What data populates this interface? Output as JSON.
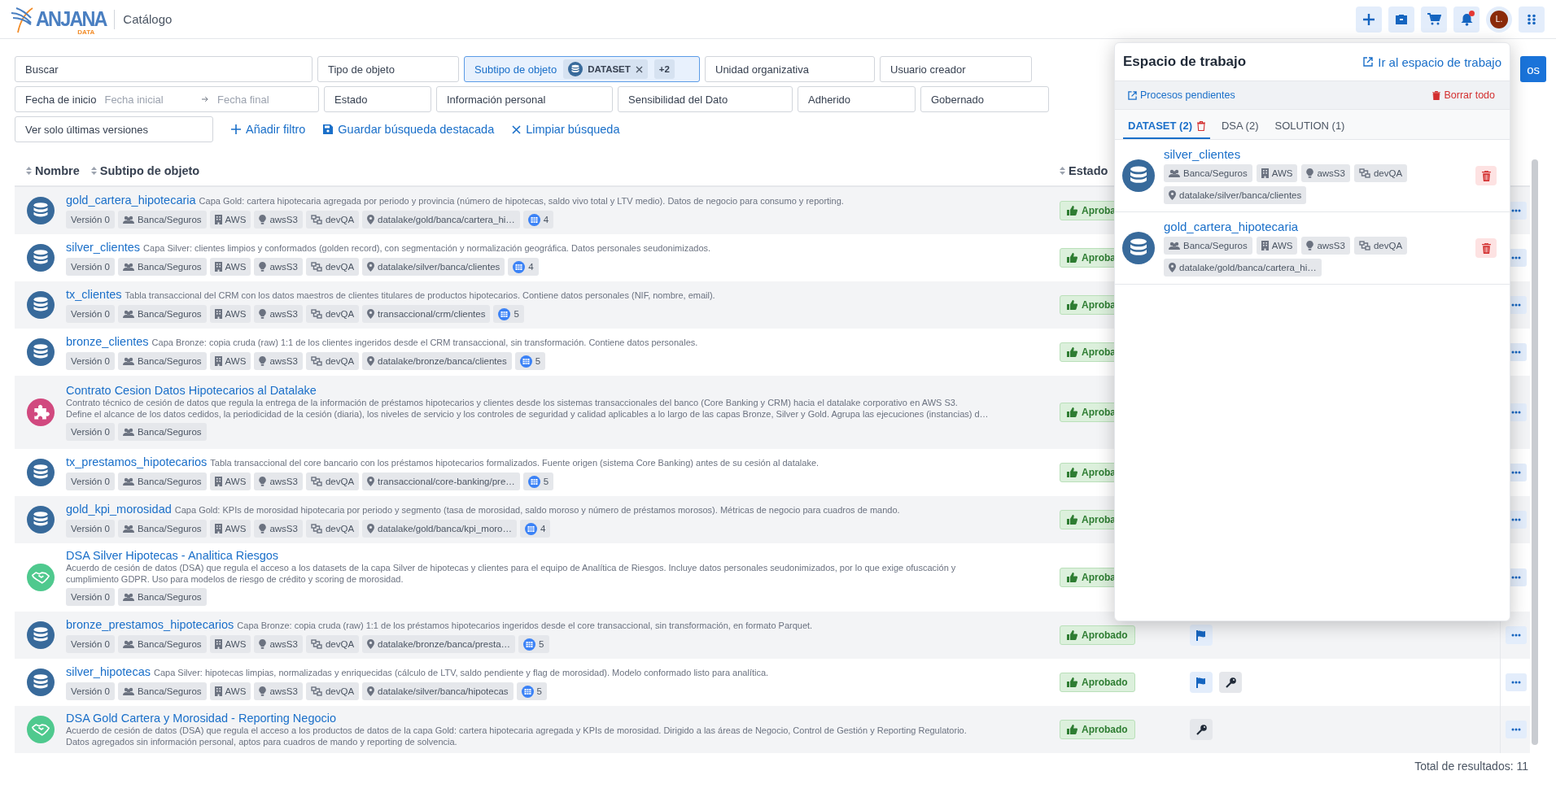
{
  "header": {
    "logo": {
      "name": "ANJANA",
      "sub": "DATA"
    },
    "section": "Catálogo",
    "buttons": [
      {
        "kind": "add"
      },
      {
        "kind": "briefcase"
      },
      {
        "kind": "cart"
      },
      {
        "kind": "bell",
        "notification": true
      },
      {
        "kind": "avatar",
        "label": "L."
      },
      {
        "kind": "apps"
      }
    ]
  },
  "filters": {
    "fields": [
      {
        "label": "Buscar",
        "active": false
      },
      {
        "label": "Tipo de objeto",
        "active": false
      },
      {
        "label": "Subtipo de objeto",
        "active": true,
        "chips": [
          {
            "label": "DATASET",
            "kind": "dataset",
            "removable": true
          },
          {
            "label": "+2",
            "kind": "count",
            "removable": false
          }
        ]
      },
      {
        "label": "Unidad organizativa",
        "active": false
      },
      {
        "label": "Usuario creador",
        "active": false
      },
      {
        "kind": "date_range",
        "label": "Fecha de inicio",
        "from_placeholder": "Fecha inicial",
        "to_placeholder": "Fecha final",
        "active": false
      },
      {
        "label": "Estado",
        "active": false
      },
      {
        "label": "Información personal",
        "active": false
      },
      {
        "label": "Sensibilidad del Dato",
        "active": false
      },
      {
        "label": "Adherido",
        "active": false
      },
      {
        "label": "Gobernado",
        "active": false
      },
      {
        "label": "Ver solo últimas versiones",
        "active": false
      }
    ],
    "actions": [
      {
        "kind": "add",
        "label": "Añadir filtro"
      },
      {
        "kind": "save",
        "label": "Guardar búsqueda destacada"
      },
      {
        "kind": "clear",
        "label": "Limpiar búsqueda"
      }
    ],
    "search_button": "os"
  },
  "table": {
    "columns": [
      {
        "label": "Nombre",
        "sortable": true
      },
      {
        "label": "Subtipo de objeto",
        "sortable": true
      },
      {
        "label": "Estado",
        "sortable": true
      }
    ],
    "rows": [
      {
        "kind": "dataset",
        "name": "gold_cartera_hipotecaria",
        "description": "Capa Gold: cartera hipotecaria agregada por periodo y provincia (número de hipotecas, saldo vivo total y LTV medio). Datos de negocio para consumo y reporting.",
        "tags": [
          {
            "kind": "version",
            "label": "Versión 0"
          },
          {
            "kind": "domain",
            "label": "Banca/Seguros"
          },
          {
            "kind": "system",
            "label": "AWS"
          },
          {
            "kind": "tech",
            "label": "awsS3"
          },
          {
            "kind": "env",
            "label": "devQA"
          },
          {
            "kind": "path",
            "label": "datalake/gold/banca/cartera_hi…"
          },
          {
            "kind": "columns",
            "label": "4"
          }
        ],
        "status": "Aproba"
      },
      {
        "kind": "dataset",
        "name": "silver_clientes",
        "description": "Capa Silver: clientes limpios y conformados (golden record), con segmentación y normalización geográfica. Datos personales seudonimizados.",
        "tags": [
          {
            "kind": "version",
            "label": "Versión 0"
          },
          {
            "kind": "domain",
            "label": "Banca/Seguros"
          },
          {
            "kind": "system",
            "label": "AWS"
          },
          {
            "kind": "tech",
            "label": "awsS3"
          },
          {
            "kind": "env",
            "label": "devQA"
          },
          {
            "kind": "path",
            "label": "datalake/silver/banca/clientes"
          },
          {
            "kind": "columns",
            "label": "4"
          }
        ],
        "status": "Aproba"
      },
      {
        "kind": "dataset",
        "name": "tx_clientes",
        "description": "Tabla transaccional del CRM con los datos maestros de clientes titulares de productos hipotecarios. Contiene datos personales (NIF, nombre, email).",
        "tags": [
          {
            "kind": "version",
            "label": "Versión 0"
          },
          {
            "kind": "domain",
            "label": "Banca/Seguros"
          },
          {
            "kind": "system",
            "label": "AWS"
          },
          {
            "kind": "tech",
            "label": "awsS3"
          },
          {
            "kind": "env",
            "label": "devQA"
          },
          {
            "kind": "path",
            "label": "transaccional/crm/clientes"
          },
          {
            "kind": "columns",
            "label": "5"
          }
        ],
        "status": "Aproba"
      },
      {
        "kind": "dataset",
        "name": "bronze_clientes",
        "description": "Capa Bronze: copia cruda (raw) 1:1 de los clientes ingeridos desde el CRM transaccional, sin transformación. Contiene datos personales.",
        "tags": [
          {
            "kind": "version",
            "label": "Versión 0"
          },
          {
            "kind": "domain",
            "label": "Banca/Seguros"
          },
          {
            "kind": "system",
            "label": "AWS"
          },
          {
            "kind": "tech",
            "label": "awsS3"
          },
          {
            "kind": "env",
            "label": "devQA"
          },
          {
            "kind": "path",
            "label": "datalake/bronze/banca/clientes"
          },
          {
            "kind": "columns",
            "label": "5"
          }
        ],
        "status": "Aproba"
      },
      {
        "kind": "contract",
        "name": "Contrato Cesion Datos Hipotecarios al Datalake",
        "description_lines": [
          "Contrato técnico de cesión de datos que regula la entrega de la información de préstamos hipotecarios y clientes desde los sistemas transaccionales del banco (Core Banking y CRM) hacia el datalake corporativo en AWS S3.",
          "Define el alcance de los datos cedidos, la periodicidad de la cesión (diaria), los niveles de servicio y los controles de seguridad y calidad aplicables a lo largo de las capas Bronze, Silver y Gold. Agrupa las ejecuciones (instancias) d…"
        ],
        "tags": [
          {
            "kind": "version",
            "label": "Versión 0"
          },
          {
            "kind": "domain",
            "label": "Banca/Seguros"
          }
        ],
        "status": "Aproba"
      },
      {
        "kind": "dataset",
        "name": "tx_prestamos_hipotecarios",
        "description": "Tabla transaccional del core bancario con los préstamos hipotecarios formalizados. Fuente origen (sistema Core Banking) antes de su cesión al datalake.",
        "tags": [
          {
            "kind": "version",
            "label": "Versión 0"
          },
          {
            "kind": "domain",
            "label": "Banca/Seguros"
          },
          {
            "kind": "system",
            "label": "AWS"
          },
          {
            "kind": "tech",
            "label": "awsS3"
          },
          {
            "kind": "env",
            "label": "devQA"
          },
          {
            "kind": "path",
            "label": "transaccional/core-banking/pre…"
          },
          {
            "kind": "columns",
            "label": "5"
          }
        ],
        "status": "Aproba"
      },
      {
        "kind": "dataset",
        "name": "gold_kpi_morosidad",
        "description": "Capa Gold: KPIs de morosidad hipotecaria por periodo y segmento (tasa de morosidad, saldo moroso y número de préstamos morosos). Métricas de negocio para cuadros de mando.",
        "tags": [
          {
            "kind": "version",
            "label": "Versión 0"
          },
          {
            "kind": "domain",
            "label": "Banca/Seguros"
          },
          {
            "kind": "system",
            "label": "AWS"
          },
          {
            "kind": "tech",
            "label": "awsS3"
          },
          {
            "kind": "env",
            "label": "devQA"
          },
          {
            "kind": "path",
            "label": "datalake/gold/banca/kpi_moro…"
          },
          {
            "kind": "columns",
            "label": "4"
          }
        ],
        "status": "Aproba"
      },
      {
        "kind": "dsa",
        "name": "DSA Silver Hipotecas - Analitica Riesgos",
        "description_lines": [
          "Acuerdo de cesión de datos (DSA) que regula el acceso a los datasets de la capa Silver de hipotecas y clientes para el equipo de Analítica de Riesgos. Incluye datos personales seudonimizados, por lo que exige ofuscación y",
          "cumplimiento GDPR. Uso para modelos de riesgo de crédito y scoring de morosidad."
        ],
        "tags": [
          {
            "kind": "version",
            "label": "Versión 0"
          },
          {
            "kind": "domain",
            "label": "Banca/Seguros"
          }
        ],
        "status": "Aproba"
      },
      {
        "kind": "dataset",
        "name": "bronze_prestamos_hipotecarios",
        "description": "Capa Bronze: copia cruda (raw) 1:1 de los préstamos hipotecarios ingeridos desde el core transaccional, sin transformación, en formato Parquet.",
        "tags": [
          {
            "kind": "version",
            "label": "Versión 0"
          },
          {
            "kind": "domain",
            "label": "Banca/Seguros"
          },
          {
            "kind": "system",
            "label": "AWS"
          },
          {
            "kind": "tech",
            "label": "awsS3"
          },
          {
            "kind": "env",
            "label": "devQA"
          },
          {
            "kind": "path",
            "label": "datalake/bronze/banca/presta…"
          },
          {
            "kind": "columns",
            "label": "5"
          }
        ],
        "status": "Aprobado",
        "markers": [
          {
            "kind": "flag"
          }
        ]
      },
      {
        "kind": "dataset",
        "name": "silver_hipotecas",
        "description": "Capa Silver: hipotecas limpias, normalizadas y enriquecidas (cálculo de LTV, saldo pendiente y flag de morosidad). Modelo conformado listo para analítica.",
        "tags": [
          {
            "kind": "version",
            "label": "Versión 0"
          },
          {
            "kind": "domain",
            "label": "Banca/Seguros"
          },
          {
            "kind": "system",
            "label": "AWS"
          },
          {
            "kind": "tech",
            "label": "awsS3"
          },
          {
            "kind": "env",
            "label": "devQA"
          },
          {
            "kind": "path",
            "label": "datalake/silver/banca/hipotecas"
          },
          {
            "kind": "columns",
            "label": "5"
          }
        ],
        "status": "Aprobado",
        "markers": [
          {
            "kind": "flag"
          },
          {
            "kind": "key"
          }
        ]
      },
      {
        "kind": "dsa",
        "name": "DSA Gold Cartera y Morosidad - Reporting Negocio",
        "description_lines": [
          "Acuerdo de cesión de datos (DSA) que regula el acceso a los productos de datos de la capa Gold: cartera hipotecaria agregada y KPIs de morosidad. Dirigido a las áreas de Negocio, Control de Gestión y Reporting Regulatorio.",
          "Datos agregados sin información personal, aptos para cuadros de mando y reporting de solvencia."
        ],
        "status": "Aprobado",
        "markers": [
          {
            "kind": "key"
          }
        ]
      }
    ],
    "total": "Total de resultados: 11"
  },
  "workspace": {
    "title": "Espacio de trabajo",
    "open_link": "Ir al espacio de trabajo",
    "pending_link": "Procesos pendientes",
    "clear_all": "Borrar todo",
    "tabs": [
      {
        "label": "DATASET (2)",
        "selected": true
      },
      {
        "label": "DSA (2)",
        "selected": false
      },
      {
        "label": "SOLUTION (1)",
        "selected": false
      }
    ],
    "items": [
      {
        "kind": "dataset",
        "name": "silver_clientes",
        "tags": [
          {
            "kind": "domain",
            "label": "Banca/Seguros"
          },
          {
            "kind": "system",
            "label": "AWS"
          },
          {
            "kind": "tech",
            "label": "awsS3"
          },
          {
            "kind": "env",
            "label": "devQA"
          },
          {
            "kind": "path",
            "label": "datalake/silver/banca/clientes"
          }
        ]
      },
      {
        "kind": "dataset",
        "name": "gold_cartera_hipotecaria",
        "tags": [
          {
            "kind": "domain",
            "label": "Banca/Seguros"
          },
          {
            "kind": "system",
            "label": "AWS"
          },
          {
            "kind": "tech",
            "label": "awsS3"
          },
          {
            "kind": "env",
            "label": "devQA"
          },
          {
            "kind": "path",
            "label": "datalake/gold/banca/cartera_hi…"
          }
        ]
      }
    ]
  }
}
